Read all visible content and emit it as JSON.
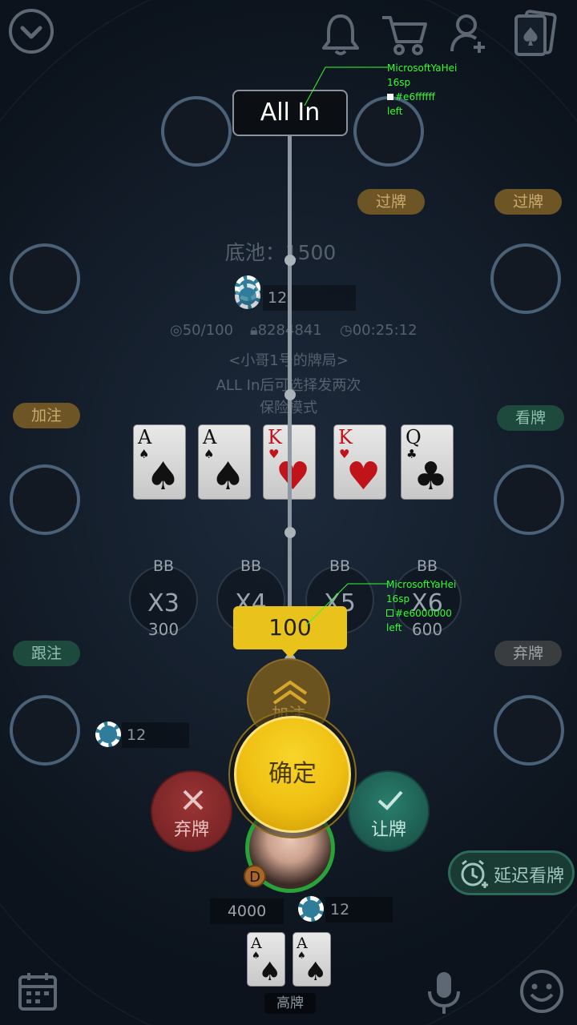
{
  "top_bar": {
    "icons": [
      "chevron-down-circle-icon",
      "bell-icon",
      "cart-icon",
      "add-user-icon",
      "cards-icon"
    ]
  },
  "action_pills": {
    "pass_top_left": "过牌",
    "pass_top_right": "过牌",
    "raise": "加注",
    "look": "看牌",
    "call": "跟注",
    "fold_pill": "弃牌"
  },
  "pot": {
    "label": "底池：1500",
    "chip_count": "12"
  },
  "room_info": {
    "blinds": "50/100",
    "id": "8284841",
    "time": "00:25:12",
    "room_name": "<小哥1号的牌局>",
    "rule_line1": "ALL In后可选择发两次",
    "rule_line2": "保险模式"
  },
  "community_cards": [
    {
      "rank": "A",
      "suit": "♠",
      "color": "black"
    },
    {
      "rank": "A",
      "suit": "♠",
      "color": "black"
    },
    {
      "rank": "K",
      "suit": "♥",
      "color": "red"
    },
    {
      "rank": "K",
      "suit": "♥",
      "color": "red"
    },
    {
      "rank": "Q",
      "suit": "♣",
      "color": "black"
    }
  ],
  "multipliers": [
    {
      "bb": "BB",
      "x": "X3",
      "value": "300"
    },
    {
      "bb": "BB",
      "x": "X4",
      "value": ""
    },
    {
      "bb": "BB",
      "x": "X5",
      "value": "0"
    },
    {
      "bb": "BB",
      "x": "X6",
      "value": "600"
    }
  ],
  "slider": {
    "top_label": "All In",
    "current_value": "100"
  },
  "annotation_top": {
    "font": "MicrosoftYaHei",
    "size": "16sp",
    "color": "#e6ffffff",
    "align": "left"
  },
  "annotation_mid": {
    "font": "MicrosoftYaHei",
    "size": "16sp",
    "color": "#e6000000",
    "align": "left"
  },
  "buttons": {
    "raise_label": "加注",
    "confirm": "确定",
    "fold": "弃牌",
    "check": "让牌",
    "delay_look": "延迟看牌"
  },
  "left_player": {
    "chip_count": "12"
  },
  "hero": {
    "dealer_badge": "D",
    "stack": "4000",
    "chip_count": "12",
    "hand_rank": "高牌",
    "cards": [
      {
        "rank": "A",
        "suit": "♠",
        "color": "black"
      },
      {
        "rank": "A",
        "suit": "♠",
        "color": "black"
      }
    ]
  },
  "bottom_bar": {
    "icons": [
      "calendar-icon",
      "microphone-icon",
      "smiley-icon"
    ]
  },
  "colors": {
    "confirm_gold": "#f3c21a",
    "fold_red": "#8e2b2b",
    "check_teal": "#1f6b5e",
    "value_bubble": "#e9c21c"
  }
}
